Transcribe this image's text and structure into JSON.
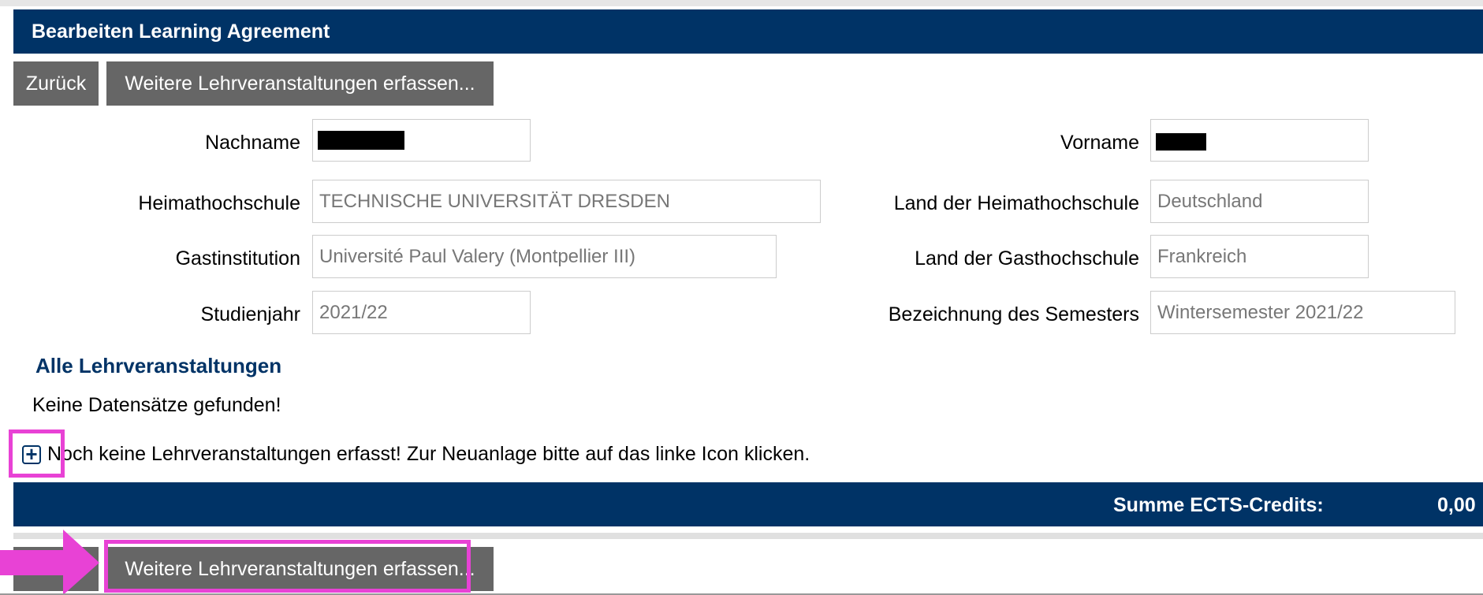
{
  "header": {
    "title": "Bearbeiten Learning Agreement"
  },
  "toolbar_top": {
    "back_label": "Zurück",
    "add_courses_label": "Weitere Lehrveranstaltungen erfassen..."
  },
  "form": {
    "nachname": {
      "label": "Nachname",
      "value": ""
    },
    "vorname": {
      "label": "Vorname",
      "value": ""
    },
    "heimathochschule": {
      "label": "Heimathochschule",
      "value": "TECHNISCHE UNIVERSITÄT DRESDEN"
    },
    "land_heimathochschule": {
      "label": "Land der Heimathochschule",
      "value": "Deutschland"
    },
    "gastinstitution": {
      "label": "Gastinstitution",
      "value": "Université Paul Valery (Montpellier III)"
    },
    "land_gasthochschule": {
      "label": "Land der Gasthochschule",
      "value": "Frankreich"
    },
    "studienjahr": {
      "label": "Studienjahr",
      "value": "2021/22"
    },
    "semester": {
      "label": "Bezeichnung des Semesters",
      "value": "Wintersemester 2021/22"
    }
  },
  "courses": {
    "title": "Alle Lehrveranstaltungen",
    "empty_text": "Keine Datensätze gefunden!",
    "add_icon": "plus-square-icon",
    "hint": "Noch keine Lehrveranstaltungen erfasst! Zur Neuanlage bitte auf das linke Icon klicken."
  },
  "summary": {
    "label": "Summe ECTS-Credits:",
    "value": "0,00"
  },
  "toolbar_bottom": {
    "add_courses_label": "Weitere Lehrveranstaltungen erfassen..."
  },
  "colors": {
    "primary": "#003366",
    "button": "#666666",
    "highlight": "#e842d5"
  }
}
